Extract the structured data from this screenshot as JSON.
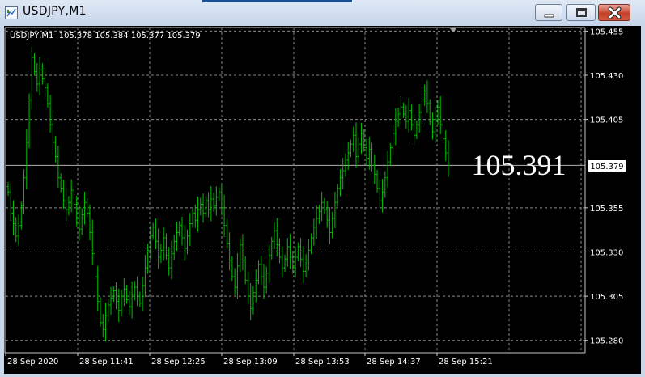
{
  "window": {
    "title": "USDJPY,M1",
    "minimize_icon": "minimize-icon",
    "maximize_icon": "maximize-icon",
    "close_icon": "close-icon"
  },
  "chart": {
    "info_line": "USDJPY,M1  105.378 105.384 105.377 105.379",
    "big_price": "105.391",
    "current_price_label": "105.379",
    "colors": {
      "background": "#000000",
      "bars": "#00c000",
      "grid": "#8a8a8a",
      "text": "#ffffff"
    }
  },
  "chart_data": {
    "type": "bar",
    "symbol": "USDJPY",
    "timeframe": "M1",
    "price_axis_ticks": [
      "105.455",
      "105.430",
      "105.405",
      "105.379",
      "105.355",
      "105.330",
      "105.305",
      "105.280"
    ],
    "time_axis_ticks": [
      "28 Sep 2020",
      "28 Sep 11:41",
      "28 Sep 12:25",
      "28 Sep 13:09",
      "28 Sep 13:53",
      "28 Sep 14:37",
      "28 Sep 15:21"
    ],
    "ylim": [
      105.273,
      105.457
    ],
    "grid": true,
    "last_bar": {
      "open": 105.378,
      "high": 105.384,
      "low": 105.377,
      "close": 105.379
    },
    "close_series": [
      105.364,
      105.352,
      105.346,
      105.339,
      105.345,
      105.356,
      105.372,
      105.392,
      105.416,
      105.44,
      105.432,
      105.425,
      105.433,
      105.428,
      105.423,
      105.414,
      105.402,
      105.392,
      105.384,
      105.372,
      105.366,
      105.359,
      105.354,
      105.358,
      105.365,
      105.357,
      105.349,
      105.343,
      105.351,
      105.358,
      105.352,
      105.341,
      105.329,
      105.316,
      105.302,
      105.29,
      105.286,
      105.294,
      105.3,
      105.304,
      105.308,
      105.302,
      105.297,
      105.305,
      105.309,
      105.303,
      105.299,
      105.306,
      105.31,
      105.305,
      105.301,
      105.311,
      105.321,
      105.331,
      105.339,
      105.344,
      105.336,
      105.327,
      105.331,
      105.338,
      105.328,
      105.321,
      105.329,
      105.336,
      105.341,
      105.345,
      105.338,
      105.332,
      105.339,
      105.346,
      105.352,
      105.348,
      105.354,
      105.357,
      105.352,
      105.359,
      105.354,
      105.36,
      105.356,
      105.361,
      105.364,
      105.355,
      105.345,
      105.335,
      105.325,
      105.316,
      105.31,
      105.322,
      105.334,
      105.325,
      105.314,
      105.305,
      105.298,
      105.307,
      105.314,
      105.323,
      105.316,
      105.31,
      105.318,
      105.328,
      105.336,
      105.342,
      105.334,
      105.327,
      105.321,
      105.326,
      105.333,
      105.327,
      105.321,
      105.327,
      105.333,
      105.326,
      105.319,
      105.325,
      105.331,
      105.338,
      105.344,
      105.349,
      105.353,
      105.358,
      105.354,
      105.348,
      105.341,
      105.349,
      105.358,
      105.366,
      105.372,
      105.376,
      105.382,
      105.386,
      105.391,
      105.396,
      105.384,
      105.391,
      105.397,
      105.389,
      105.383,
      105.388,
      105.379,
      105.374,
      105.366,
      105.359,
      105.364,
      105.372,
      105.381,
      105.389,
      105.397,
      105.404,
      105.408,
      105.412,
      105.408,
      105.404,
      105.41,
      105.402,
      105.396,
      105.402,
      105.409,
      105.416,
      105.421,
      105.414,
      105.404,
      105.398,
      105.405,
      105.412,
      105.402,
      105.394,
      105.386,
      105.379
    ]
  }
}
